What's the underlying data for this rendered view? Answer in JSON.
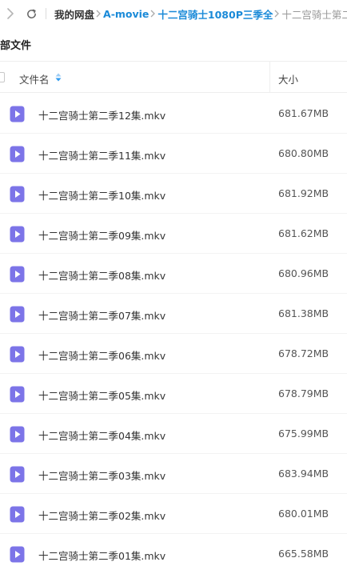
{
  "breadcrumb": {
    "root": "我的网盘",
    "items": [
      "A-movie",
      "十二宫骑士1080P三季全"
    ],
    "current": "十二宫骑士第二季"
  },
  "section_title": "部文件",
  "columns": {
    "name": "文件名",
    "size": "大小"
  },
  "files": [
    {
      "name": "十二宫骑士第二季12集.mkv",
      "size": "681.67MB"
    },
    {
      "name": "十二宫骑士第二季11集.mkv",
      "size": "680.80MB"
    },
    {
      "name": "十二宫骑士第二季10集.mkv",
      "size": "681.92MB"
    },
    {
      "name": "十二宫骑士第二季09集.mkv",
      "size": "681.62MB"
    },
    {
      "name": "十二宫骑士第二季08集.mkv",
      "size": "680.96MB"
    },
    {
      "name": "十二宫骑士第二季07集.mkv",
      "size": "681.38MB"
    },
    {
      "name": "十二宫骑士第二季06集.mkv",
      "size": "678.72MB"
    },
    {
      "name": "十二宫骑士第二季05集.mkv",
      "size": "678.79MB"
    },
    {
      "name": "十二宫骑士第二季04集.mkv",
      "size": "675.99MB"
    },
    {
      "name": "十二宫骑士第二季03集.mkv",
      "size": "683.94MB"
    },
    {
      "name": "十二宫骑士第二季02集.mkv",
      "size": "680.01MB"
    },
    {
      "name": "十二宫骑士第二季01集.mkv",
      "size": "665.58MB"
    }
  ],
  "icons": {
    "file_type": "video-file-icon",
    "forward": "chevron-right-icon",
    "refresh": "refresh-icon",
    "sort": "sort-icon"
  },
  "colors": {
    "link": "#1a8ad8",
    "video_icon": "#7c74e8",
    "sort_icon": "#2f9bf0"
  }
}
